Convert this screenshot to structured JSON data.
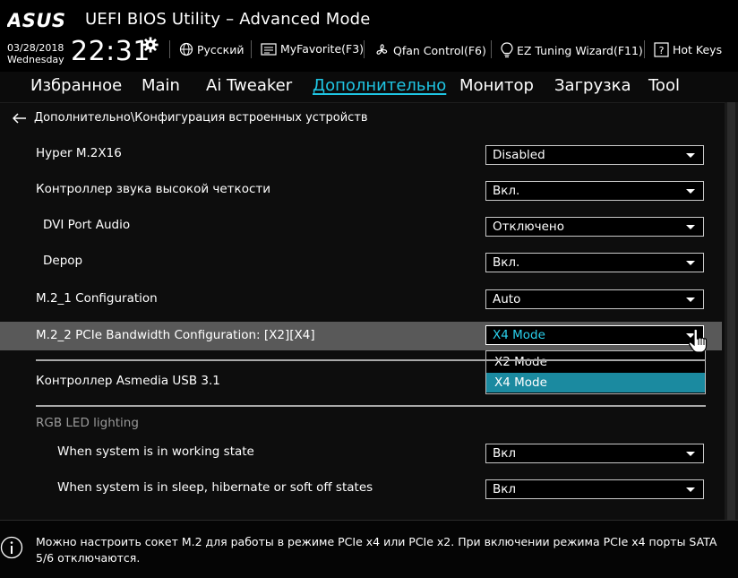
{
  "header": {
    "brand": "ASUS",
    "title": "UEFI BIOS Utility – Advanced Mode",
    "date": "03/28/2018",
    "weekday": "Wednesday",
    "time": "22:31",
    "toolbar": [
      {
        "label": "Русский",
        "icon": "globe-icon"
      },
      {
        "label": "MyFavorite(F3)",
        "icon": "favorite-list-icon"
      },
      {
        "label": "Qfan Control(F6)",
        "icon": "fan-icon"
      },
      {
        "label": "EZ Tuning Wizard(F11)",
        "icon": "lightbulb-icon"
      },
      {
        "label": "Hot Keys",
        "icon": "help-key-icon"
      }
    ]
  },
  "tabs": [
    "Избранное",
    "Main",
    "Ai Tweaker",
    "Дополнительно",
    "Монитор",
    "Загрузка",
    "Tool"
  ],
  "active_tab": "Дополнительно",
  "breadcrumb": "Дополнительно\\Конфигурация встроенных устройств",
  "settings": [
    {
      "label": "Hyper M.2X16",
      "value": "Disabled"
    },
    {
      "label": "Контроллер звука высокой четкости",
      "value": "Вкл."
    },
    {
      "label": "DVI Port Audio",
      "value": "Отключено"
    },
    {
      "label": "Depop",
      "value": "Вкл."
    },
    {
      "label": "M.2_1 Configuration",
      "value": "Auto"
    },
    {
      "label": "M.2_2 PCIe Bandwidth Configuration: [X2][X4]",
      "value": "X4 Mode"
    },
    {
      "label": "Контроллер Asmedia USB 3.1"
    }
  ],
  "dropdown": {
    "options": [
      "X2 Mode",
      "X4 Mode"
    ],
    "selected": "X4 Mode"
  },
  "rgb_section": {
    "title": "RGB LED lighting",
    "settings": [
      {
        "label": "When system is in working state",
        "value": "Вкл"
      },
      {
        "label": "When system is in sleep, hibernate or soft off states",
        "value": "Вкл"
      }
    ]
  },
  "help_text": "Можно настроить сокет M.2 для работы в режиме PCIe x4 или PCIe x2. При включении режима PCIe x4 порты SATA 5/6 отключаются.",
  "colors": {
    "accent": "#1fc6e4",
    "highlight_row": "#595959",
    "selected_option": "#1b8aa0",
    "background": "#0d0d0d"
  }
}
